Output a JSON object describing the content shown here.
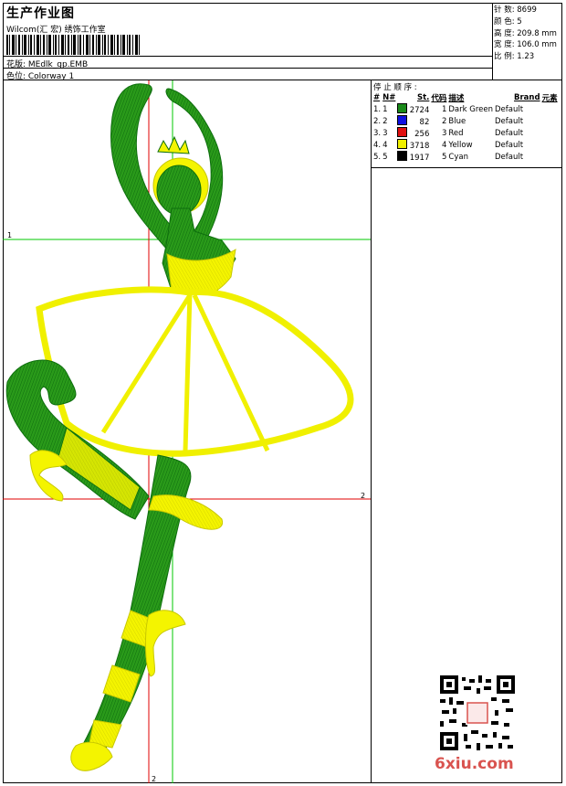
{
  "header": {
    "title": "生产作业图",
    "studio": "Wilcom(汇 宏) 绣饰工作室",
    "design_name": "花版:  MEdlk_gp.EMB",
    "colorway": "色位:  Colorway 1"
  },
  "stats": {
    "stitches": "针 数:  8699",
    "colors": "颜 色:  5",
    "height": "高 度:  209.8 mm",
    "width": "宽 度:  106.0 mm",
    "scale": "比 例:  1.23"
  },
  "stop_sequence": {
    "label": "停 止 顺 序 :",
    "columns": [
      "#",
      "N#",
      "St.",
      "代码",
      "描述",
      "Brand",
      "元素"
    ],
    "rows": [
      {
        "idx": "1.",
        "n": "1",
        "st": "2724",
        "code": "1",
        "desc": "Dark Green",
        "brand": "Default",
        "color": "#1a8a1a"
      },
      {
        "idx": "2.",
        "n": "2",
        "st": "82",
        "code": "2",
        "desc": "Blue",
        "brand": "Default",
        "color": "#1010e0"
      },
      {
        "idx": "3.",
        "n": "3",
        "st": "256",
        "code": "3",
        "desc": "Red",
        "brand": "Default",
        "color": "#e01010"
      },
      {
        "idx": "4.",
        "n": "4",
        "st": "3718",
        "code": "4",
        "desc": "Yellow",
        "brand": "Default",
        "color": "#f0f000"
      },
      {
        "idx": "5.",
        "n": "5",
        "st": "1917",
        "code": "5",
        "desc": "Cyan",
        "brand": "Default",
        "color": "#000000"
      }
    ]
  },
  "guides": {
    "h1": "1",
    "h2": "2",
    "v2": "2"
  },
  "watermark": "6xiu.com"
}
